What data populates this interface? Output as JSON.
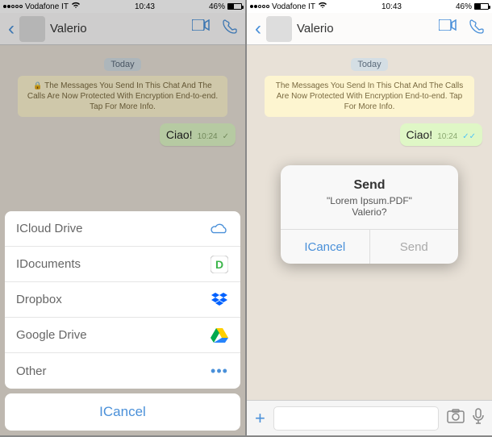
{
  "statusbar": {
    "carrier": "Vodafone IT",
    "time": "10:43",
    "battery": "46%"
  },
  "header": {
    "contact": "Valerio"
  },
  "chat": {
    "day_label": "Today",
    "info_banner": "The Messages You Send In This Chat And The Calls Are Now Protected With Encryption End-to-end. Tap For More Info.",
    "message": {
      "text": "Ciao!",
      "time": "10:24"
    }
  },
  "sheet": {
    "items": [
      {
        "label": "ICloud Drive",
        "icon": "icloud"
      },
      {
        "label": "IDocuments",
        "icon": "documents"
      },
      {
        "label": "Dropbox",
        "icon": "dropbox"
      },
      {
        "label": "Google Drive",
        "icon": "gdrive"
      },
      {
        "label": "Other",
        "icon": "more"
      }
    ],
    "cancel": "ICancel"
  },
  "alert": {
    "title": "Send",
    "filename": "\"Lorem Ipsum.PDF\"",
    "recipient": "Valerio?",
    "cancel": "ICancel",
    "send": "Send"
  }
}
